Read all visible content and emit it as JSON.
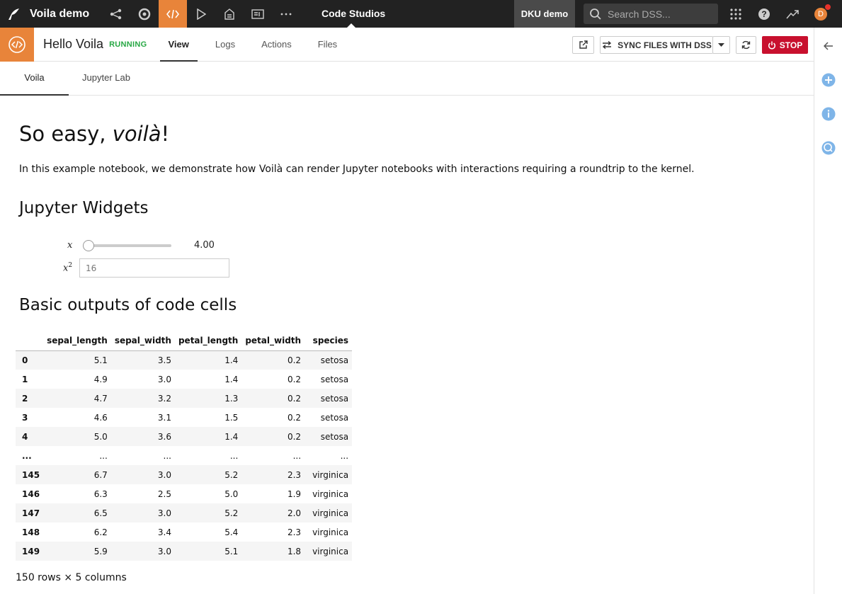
{
  "topbar": {
    "project_name": "Voila demo",
    "app_title": "Code Studios",
    "instance_name": "DKU demo",
    "search_placeholder": "Search DSS...",
    "avatar_initial": "D",
    "accent_color": "#E8843A"
  },
  "subheader": {
    "studio_name": "Hello Voila",
    "status": "RUNNING",
    "tabs": [
      {
        "label": "View",
        "active": true
      },
      {
        "label": "Logs",
        "active": false
      },
      {
        "label": "Actions",
        "active": false
      },
      {
        "label": "Files",
        "active": false
      }
    ],
    "sync_label": "SYNC FILES WITH DSS",
    "stop_label": "STOP"
  },
  "inner_tabs": [
    {
      "label": "Voila",
      "active": true
    },
    {
      "label": "Jupyter Lab",
      "active": false
    }
  ],
  "notebook": {
    "title_prefix": "So easy, ",
    "title_em": "voilà",
    "title_suffix": "!",
    "intro": "In this example notebook, we demonstrate how Voilà can render Jupyter notebooks with interactions requiring a roundtrip to the kernel.",
    "widgets_heading": "Jupyter Widgets",
    "slider": {
      "label": "x",
      "value": "4.00",
      "fraction": 0.0
    },
    "squared": {
      "label": "x",
      "superscript": "2",
      "value": "16"
    },
    "outputs_heading": "Basic outputs of code cells",
    "dataframe": {
      "columns": [
        "",
        "sepal_length",
        "sepal_width",
        "petal_length",
        "petal_width",
        "species"
      ],
      "rows": [
        [
          "0",
          "5.1",
          "3.5",
          "1.4",
          "0.2",
          "setosa"
        ],
        [
          "1",
          "4.9",
          "3.0",
          "1.4",
          "0.2",
          "setosa"
        ],
        [
          "2",
          "4.7",
          "3.2",
          "1.3",
          "0.2",
          "setosa"
        ],
        [
          "3",
          "4.6",
          "3.1",
          "1.5",
          "0.2",
          "setosa"
        ],
        [
          "4",
          "5.0",
          "3.6",
          "1.4",
          "0.2",
          "setosa"
        ],
        [
          "...",
          "...",
          "...",
          "...",
          "...",
          "..."
        ],
        [
          "145",
          "6.7",
          "3.0",
          "5.2",
          "2.3",
          "virginica"
        ],
        [
          "146",
          "6.3",
          "2.5",
          "5.0",
          "1.9",
          "virginica"
        ],
        [
          "147",
          "6.5",
          "3.0",
          "5.2",
          "2.0",
          "virginica"
        ],
        [
          "148",
          "6.2",
          "3.4",
          "5.4",
          "2.3",
          "virginica"
        ],
        [
          "149",
          "5.9",
          "3.0",
          "5.1",
          "1.8",
          "virginica"
        ]
      ],
      "summary": "150 rows × 5 columns"
    }
  }
}
